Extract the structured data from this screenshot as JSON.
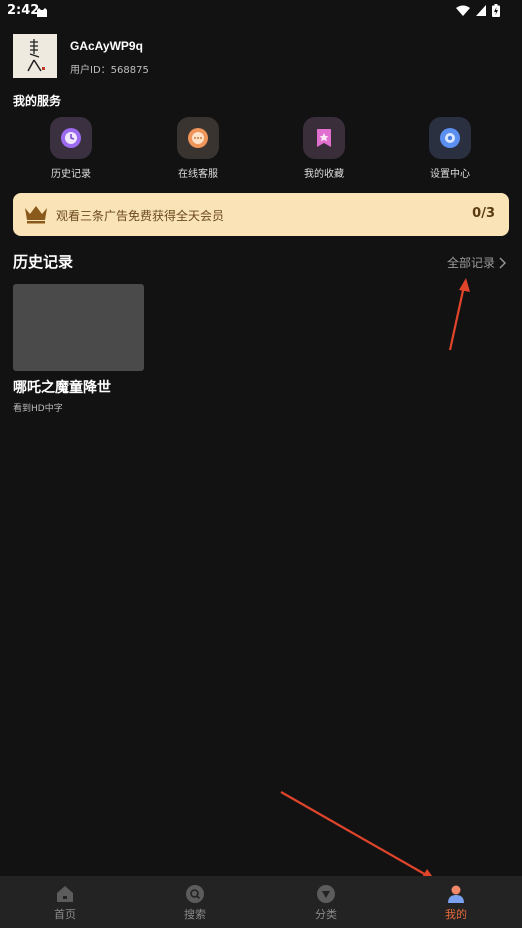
{
  "status_bar": {
    "time": "2:42"
  },
  "profile": {
    "username": "GAcAyWP9q",
    "user_id_label": "用户ID：",
    "user_id": "568875"
  },
  "services": {
    "title": "我的服务",
    "items": [
      {
        "label": "历史记录",
        "icon": "clock-icon"
      },
      {
        "label": "在线客服",
        "icon": "chat-icon"
      },
      {
        "label": "我的收藏",
        "icon": "bookmark-star-icon"
      },
      {
        "label": "设置中心",
        "icon": "gear-icon"
      }
    ]
  },
  "banner": {
    "text": "观看三条广告免费获得全天会员",
    "progress": "0/3"
  },
  "history": {
    "title": "历史记录",
    "view_all": "全部记录",
    "items": [
      {
        "title": "哪吒之魔童降世",
        "subtitle": "看到HD中字"
      }
    ]
  },
  "tabbar": {
    "items": [
      {
        "label": "首页",
        "icon": "home-icon"
      },
      {
        "label": "搜索",
        "icon": "search-icon"
      },
      {
        "label": "分类",
        "icon": "category-icon"
      },
      {
        "label": "我的",
        "icon": "user-icon"
      }
    ],
    "active": "我的"
  },
  "colors": {
    "accent": "#e46a3a",
    "banner_bg": "#fbe3b8",
    "background": "#121212",
    "annotation_arrow": "#e0452c"
  }
}
